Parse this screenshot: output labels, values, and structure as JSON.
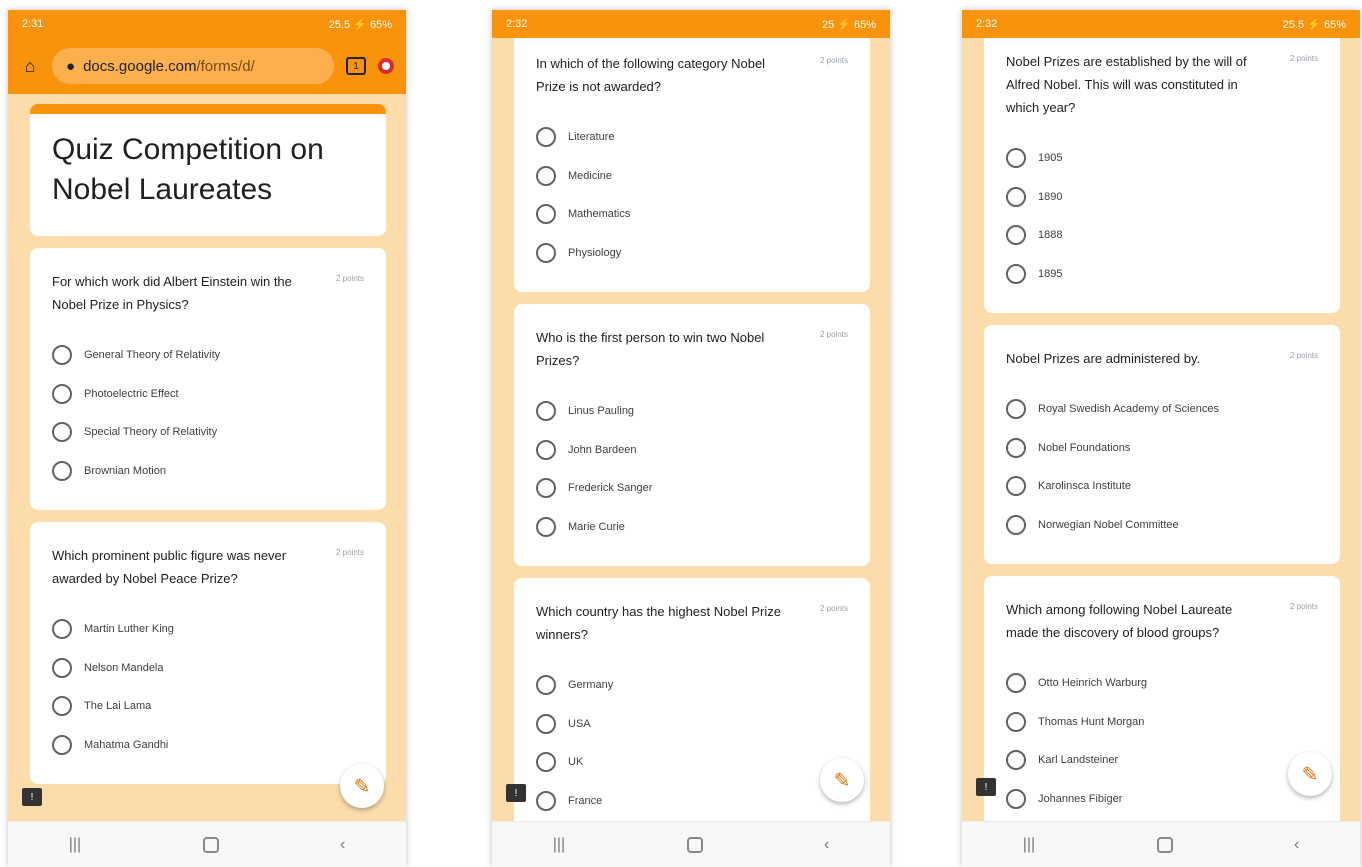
{
  "phone1": {
    "status": {
      "time": "2:31",
      "right": "25.5 ⚡ 65%"
    },
    "url_domain": "docs.google.com",
    "url_path": "/forms/d/",
    "form_title": "Quiz Competition on Nobel Laureates",
    "questions": [
      {
        "text": "For which work did Albert Einstein win the Nobel Prize in Physics?",
        "points": "2 points",
        "options": [
          "General Theory of Relativity",
          "Photoelectric Effect",
          "Special Theory of Relativity",
          "Brownian Motion"
        ]
      },
      {
        "text": "Which prominent public figure was never awarded by Nobel Peace Prize?",
        "points": "2 points",
        "options": [
          "Martin Luther King",
          "Nelson Mandela",
          "The Lai Lama",
          "Mahatma Gandhi"
        ]
      }
    ]
  },
  "phone2": {
    "status": {
      "time": "2:32",
      "right": "25 ⚡ 65%"
    },
    "questions": [
      {
        "text": "In which of the following category Nobel Prize is not awarded?",
        "points": "2 points",
        "options": [
          "Literature",
          "Medicine",
          "Mathematics",
          "Physiology"
        ]
      },
      {
        "text": "Who is the first person to win two Nobel Prizes?",
        "points": "2 points",
        "options": [
          "Linus Pauling",
          "John Bardeen",
          "Frederick Sanger",
          "Marie Curie"
        ]
      },
      {
        "text": "Which country has the highest Nobel Prize winners?",
        "points": "2 points",
        "options": [
          "Germany",
          "USA",
          "UK",
          "France"
        ]
      }
    ]
  },
  "phone3": {
    "status": {
      "time": "2:32",
      "right": "25.5 ⚡ 65%"
    },
    "questions": [
      {
        "text": "Nobel Prizes are established by the will of Alfred Nobel. This will was constituted in which year?",
        "points": "2 points",
        "options": [
          "1905",
          "1890",
          "1888",
          "1895"
        ]
      },
      {
        "text": "Nobel Prizes are administered by.",
        "points": "2 points",
        "options": [
          "Royal Swedish Academy of Sciences",
          "Nobel Foundations",
          "Karolinsca Institute",
          "Norwegian Nobel Committee"
        ]
      },
      {
        "text": "Which among following Nobel Laureate made the discovery of blood groups?",
        "points": "2 points",
        "options": [
          "Otto Heinrich Warburg",
          "Thomas Hunt Morgan",
          "Karl Landsteiner",
          "Johannes Fibiger"
        ]
      }
    ]
  },
  "icons": {
    "home": "⌂",
    "back": "‹",
    "recents": "|||",
    "edit": "✎",
    "feedback": "!"
  },
  "colors": {
    "accent": "#f8930b",
    "background": "#fbdcaa"
  }
}
